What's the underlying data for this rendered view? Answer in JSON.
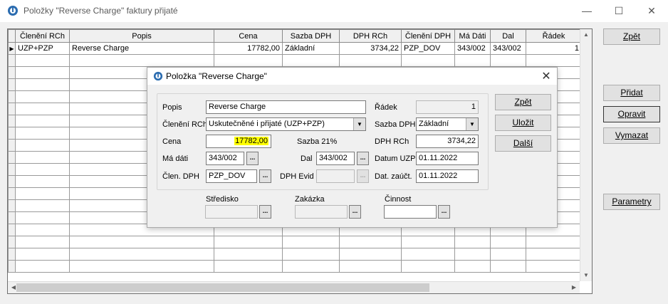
{
  "window": {
    "title": "Položky \"Reverse Charge\" faktury přijaté",
    "minimize": "—",
    "maximize": "☐",
    "close": "✕"
  },
  "grid": {
    "headers": [
      "",
      "Členění RCh",
      "Popis",
      "Cena",
      "Sazba DPH",
      "DPH RCh",
      "Členění DPH",
      "Má Dáti",
      "Dal",
      "Řádek"
    ],
    "rows": [
      {
        "indicator": "▶",
        "cleneni_rch": "UZP+PZP",
        "popis": "Reverse Charge",
        "cena": "17782,00",
        "sazba_dph": "Základní",
        "dph_rch": "3734,22",
        "cleneni_dph": "PZP_DOV",
        "ma_dati": "343/002",
        "dal": "343/002",
        "radek": "1"
      }
    ]
  },
  "side_buttons": {
    "zpet": "Zpět",
    "pridat": "Přidat",
    "opravit": "Opravit",
    "vymazat": "Vymazat",
    "parametry": "Parametry"
  },
  "dialog": {
    "title": "Položka \"Reverse Charge\"",
    "close": "✕",
    "labels": {
      "popis": "Popis",
      "cleneni_rch": "Členění RCh",
      "cena": "Cena",
      "sazba21": "Sazba 21%",
      "ma_dati": "Má dáti",
      "dal": "Dal",
      "clen_dph": "Člen. DPH",
      "dph_evid": "DPH Evid",
      "radek": "Řádek",
      "sazba_dph": "Sazba DPH",
      "dph_rch": "DPH RCh",
      "datum_uzp": "Datum UZP",
      "dat_zauct": "Dat. zaúčt.",
      "stredisko": "Středisko",
      "zakazka": "Zakázka",
      "cinnost": "Činnost"
    },
    "values": {
      "popis": "Reverse Charge",
      "cleneni_rch": "Uskutečněné i přijaté (UZP+PZP)",
      "cena": "17782,00",
      "ma_dati": "343/002",
      "dal": "343/002",
      "clen_dph": "PZP_DOV",
      "dph_evid": "",
      "radek": "1",
      "sazba_dph": "Základní",
      "dph_rch": "3734,22",
      "datum_uzp": "01.11.2022",
      "dat_zauct": "01.11.2022",
      "stredisko": "",
      "zakazka": "",
      "cinnost": ""
    },
    "dots": "...",
    "buttons": {
      "zpet": "Zpět",
      "ulozit": "Uložit",
      "dalsi": "Další"
    }
  }
}
